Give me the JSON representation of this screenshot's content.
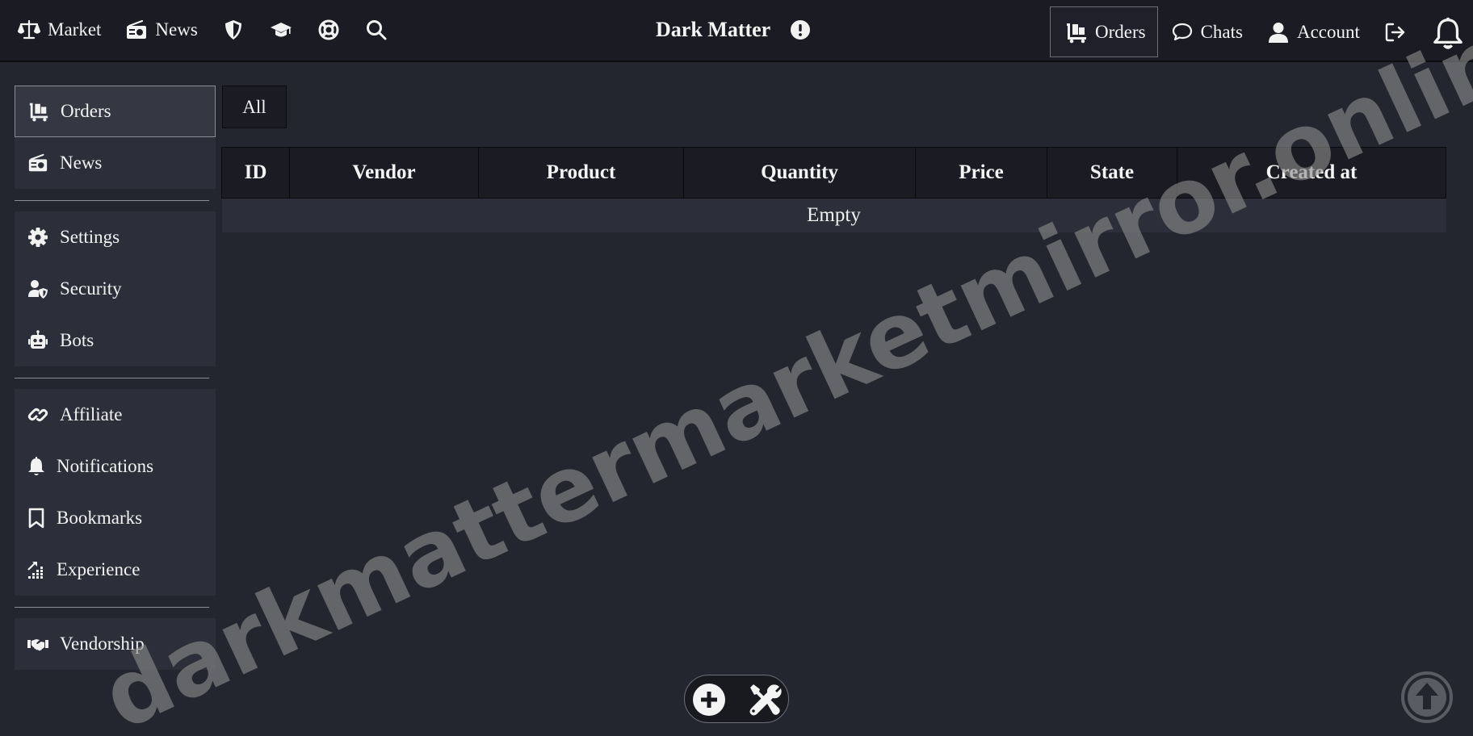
{
  "header": {
    "brand": "Dark Matter",
    "left_nav": [
      {
        "label": "Market",
        "icon": "scale-icon"
      },
      {
        "label": "News",
        "icon": "radio-icon"
      },
      {
        "label": "",
        "icon": "shield-icon"
      },
      {
        "label": "",
        "icon": "graduation-cap-icon"
      },
      {
        "label": "",
        "icon": "life-ring-icon"
      },
      {
        "label": "",
        "icon": "search-icon"
      }
    ],
    "right_nav": [
      {
        "label": "Orders",
        "icon": "cart-flatbed-icon",
        "active": true
      },
      {
        "label": "Chats",
        "icon": "chat-bubble-icon"
      },
      {
        "label": "Account",
        "icon": "user-icon"
      },
      {
        "label": "",
        "icon": "logout-icon"
      },
      {
        "label": "",
        "icon": "bell-icon"
      }
    ]
  },
  "sidebar": {
    "groups": [
      [
        {
          "label": "Orders",
          "icon": "cart-flatbed-icon",
          "active": true
        },
        {
          "label": "News",
          "icon": "radio-icon"
        }
      ],
      [
        {
          "label": "Settings",
          "icon": "gear-icon"
        },
        {
          "label": "Security",
          "icon": "user-shield-icon"
        },
        {
          "label": "Bots",
          "icon": "robot-icon"
        }
      ],
      [
        {
          "label": "Affiliate",
          "icon": "link-icon"
        },
        {
          "label": "Notifications",
          "icon": "bell-icon"
        },
        {
          "label": "Bookmarks",
          "icon": "bookmark-icon"
        },
        {
          "label": "Experience",
          "icon": "chart-growth-icon"
        }
      ],
      [
        {
          "label": "Vendorship",
          "icon": "handshake-icon"
        }
      ]
    ]
  },
  "main": {
    "filter_tab": "All",
    "table": {
      "columns": [
        "ID",
        "Vendor",
        "Product",
        "Quantity",
        "Price",
        "State",
        "Created at"
      ],
      "empty_text": "Empty"
    }
  },
  "watermark": "darkmattermarketmirror.online",
  "colors": {
    "background": "#23252f",
    "topbar": "#1b1c23",
    "panel": "#2c2e39",
    "text": "#f2f2f2"
  }
}
